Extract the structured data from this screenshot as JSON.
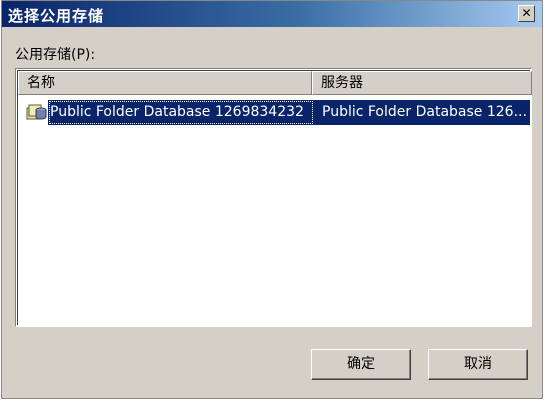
{
  "dialog": {
    "title": "选择公用存储",
    "close_glyph": "✕",
    "label": "公用存储(P):",
    "columns": [
      "名称",
      "服务器"
    ],
    "rows": [
      {
        "name": "Public Folder Database 1269834232",
        "server": "Public Folder Database 126..."
      }
    ],
    "ok_label": "确定",
    "cancel_label": "取消"
  },
  "colors": {
    "title_gradient_start": "#0a246a",
    "selection": "#0a246a",
    "face": "#d4d0c8"
  }
}
